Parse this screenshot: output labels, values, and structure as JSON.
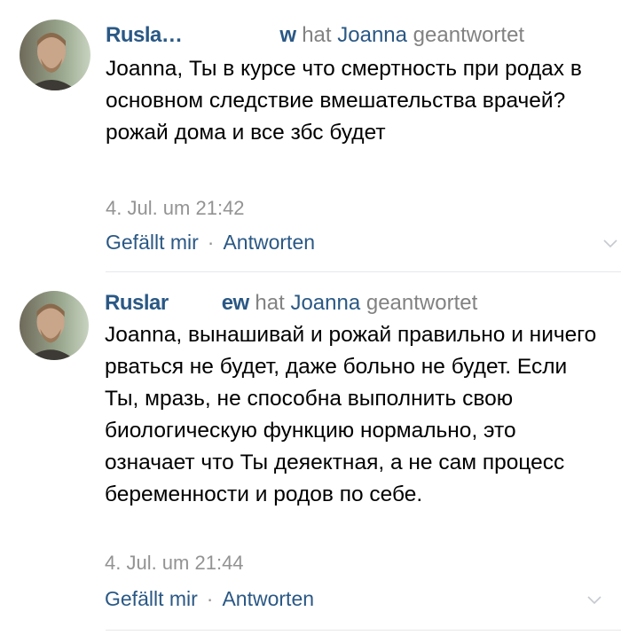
{
  "comments": [
    {
      "author": "Rusla…",
      "author_tail": "w",
      "replied_to_word": "hat",
      "replied_to": "Joanna",
      "reply_verb": "geantwortet",
      "text": "Joanna, Ты в курсе что смертность при родах в основном следствие вмешательства врачей? рожай дома и все збс будет",
      "timestamp": "4. Jul. um 21:42",
      "like_label": "Gefällt mir",
      "separator": "·",
      "reply_label": "Antworten",
      "avatar_icon": "user-photo"
    },
    {
      "author": "Ruslar",
      "author_tail": "ew",
      "replied_to_word": "hat",
      "replied_to": "Joanna",
      "reply_verb": "geantwortet",
      "text": "Joanna, вынашивай и рожай правильно и ничего рваться не будет, даже больно не будет. Если Ты, мразь, не способна выполнить свою биологическую функцию нормально, это означает что Ты деяектная, а не сам процесс беременности и родов по себе.",
      "timestamp": "4. Jul. um 21:44",
      "like_label": "Gefällt mir",
      "separator": "·",
      "reply_label": "Antworten",
      "avatar_icon": "user-photo"
    }
  ],
  "colors": {
    "link": "#2a5885",
    "meta": "#939393",
    "text": "#000000",
    "divider": "#e7e8ec"
  }
}
